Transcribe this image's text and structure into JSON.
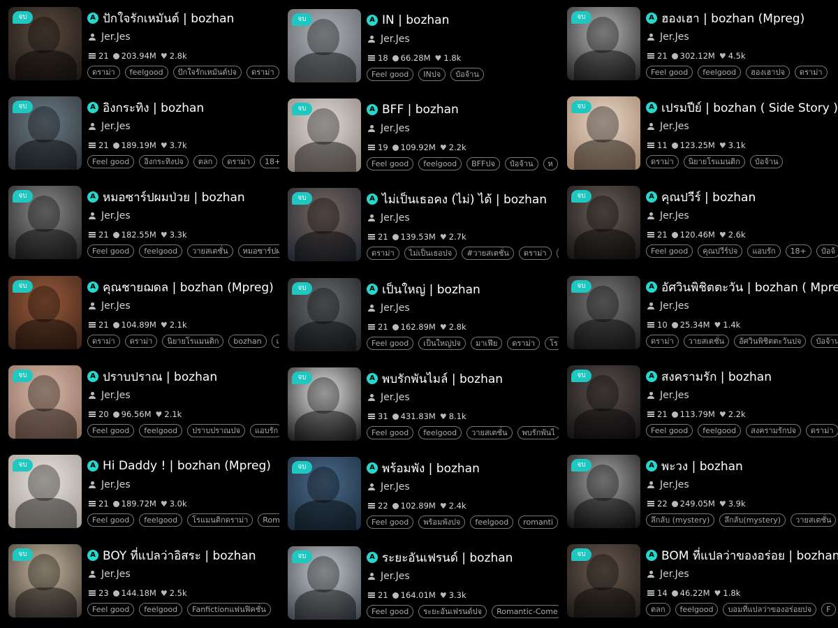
{
  "badge_label": "จบ",
  "accent_color": "#1ec8c0",
  "columns": [
    {
      "cards": [
        {
          "title": "ปักใจรักเหมันต์ | bozhan",
          "author": "Jer.Jes",
          "chapters": "21",
          "views": "203.94M",
          "likes": "2.8k",
          "tags": [
            "ดราม่า",
            "feelgood",
            "ปักใจรักเหมันต์ปจ",
            "ดราม่า"
          ],
          "cover": [
            "#5a4a3e",
            "#1a1512"
          ]
        },
        {
          "title": "อิงกระทิง | bozhan",
          "author": "Jer.Jes",
          "chapters": "21",
          "views": "189.19M",
          "likes": "3.7k",
          "tags": [
            "Feel good",
            "อิงกระทิงปจ",
            "ตลก",
            "ดราม่า",
            "18+"
          ],
          "cover": [
            "#6b7b86",
            "#2c3136"
          ]
        },
        {
          "title": "หมอซาร์ปผมป่วย | bozhan",
          "author": "Jer.Jes",
          "chapters": "21",
          "views": "182.55M",
          "likes": "3.3k",
          "tags": [
            "Feel good",
            "feelgood",
            "วายสเตชั่น",
            "หมอซาร์ปผ"
          ],
          "cover": [
            "#8c8c8c",
            "#1e1e1e"
          ]
        },
        {
          "title": "คุณชายฌดล | bozhan (Mpreg)",
          "author": "Jer.Jes",
          "chapters": "21",
          "views": "104.89M",
          "likes": "2.1k",
          "tags": [
            "ดราม่า",
            "ดราม่า",
            "นิยายโรแมนติก",
            "bozhan",
            "เ"
          ],
          "cover": [
            "#9a5a3a",
            "#3a2418"
          ]
        },
        {
          "title": "ปราบปราณ | bozhan",
          "author": "Jer.Jes",
          "chapters": "20",
          "views": "96.56M",
          "likes": "2.1k",
          "tags": [
            "Feel good",
            "feelgood",
            "ปราบปราณปจ",
            "แอบรัก"
          ],
          "cover": [
            "#d8b8a8",
            "#8a6a5a"
          ]
        },
        {
          "title": "Hi Daddy ! | bozhan (Mpreg)",
          "author": "Jer.Jes",
          "chapters": "21",
          "views": "189.72M",
          "likes": "3.0k",
          "tags": [
            "Feel good",
            "feelgood",
            "โรแมนติกดราม่า",
            "Rom"
          ],
          "cover": [
            "#e8e4e0",
            "#a09890"
          ]
        },
        {
          "title": "BOY ที่แปลว่าอิสระ  | bozhan",
          "author": "Jer.Jes",
          "chapters": "23",
          "views": "144.18M",
          "likes": "2.5k",
          "tags": [
            "Feel good",
            "feelgood",
            "Fanfictionแฟนฟิคชั่น"
          ],
          "cover": [
            "#c8b8a0",
            "#3a3430"
          ]
        }
      ]
    },
    {
      "cards": [
        {
          "title": "IN | bozhan",
          "author": "Jer.Jes",
          "chapters": "18",
          "views": "66.28M",
          "likes": "1.8k",
          "tags": [
            "Feel good",
            "INปจ",
            "ป๋อจ้าน"
          ],
          "cover": [
            "#b0b4b8",
            "#5a5e62"
          ]
        },
        {
          "title": "BFF | bozhan",
          "author": "Jer.Jes",
          "chapters": "19",
          "views": "109.92M",
          "likes": "2.2k",
          "tags": [
            "Feel good",
            "feelgood",
            "BFFปจ",
            "ป๋อจ้าน",
            "ห"
          ],
          "cover": [
            "#e0dcd8",
            "#8a7e78"
          ]
        },
        {
          "title": "ไม่เป็นเธอคง (ไม่) ได้ | bozhan",
          "author": "Jer.Jes",
          "chapters": "21",
          "views": "139.53M",
          "likes": "2.7k",
          "tags": [
            "ดราม่า",
            "ไม่เป็นเธอปจ",
            "#วายสเตชั่น",
            "ดราม่า",
            "ร"
          ],
          "cover": [
            "#7a6860",
            "#1c2430"
          ]
        },
        {
          "title": "เป็นใหญ่ | bozhan",
          "author": "Jer.Jes",
          "chapters": "21",
          "views": "162.89M",
          "likes": "2.8k",
          "tags": [
            "Feel good",
            "เป็นใหญ่ปจ",
            "มาเฟีย",
            "ดราม่า",
            "โร"
          ],
          "cover": [
            "#6a6e70",
            "#1a1c1e"
          ]
        },
        {
          "title": "พบรักพันไมล์ | bozhan",
          "author": "Jer.Jes",
          "chapters": "31",
          "views": "431.83M",
          "likes": "8.1k",
          "tags": [
            "Feel good",
            "feelgood",
            "วายสเตชั่น",
            "พบรักพันไ"
          ],
          "cover": [
            "#e8e8e8",
            "#151515"
          ]
        },
        {
          "title": "พร้อมพัง | bozhan",
          "author": "Jer.Jes",
          "chapters": "22",
          "views": "102.89M",
          "likes": "2.4k",
          "tags": [
            "Feel good",
            "พร้อมพังปจ",
            "feelgood",
            "romanti"
          ],
          "cover": [
            "#4a6a8a",
            "#1a2a3a"
          ]
        },
        {
          "title": "ระยะอันเฟรนด์ | bozhan",
          "author": "Jer.Jes",
          "chapters": "21",
          "views": "164.01M",
          "likes": "3.3k",
          "tags": [
            "Feel good",
            "ระยะอันเฟรนด์ปจ",
            "Romantic-Come"
          ],
          "cover": [
            "#c8ccd0",
            "#3a4048"
          ]
        }
      ]
    },
    {
      "cards": [
        {
          "title": "ฮองเฮา | bozhan (Mpreg)",
          "author": "Jer.Jes",
          "chapters": "21",
          "views": "302.12M",
          "likes": "4.5k",
          "tags": [
            "Feel good",
            "feelgood",
            "ฮองเฮาปจ",
            "ดราม่า"
          ],
          "cover": [
            "#b8b8b8",
            "#202020"
          ]
        },
        {
          "title": "เปรมปีย์ | bozhan ( Side Story )",
          "author": "Jer.Jes",
          "chapters": "11",
          "views": "123.25M",
          "likes": "3.1k",
          "tags": [
            "ดราม่า",
            "นิยายโรแมนติก",
            "ป๋อจ้าน"
          ],
          "cover": [
            "#e8d8c8",
            "#a08068"
          ]
        },
        {
          "title": "คุณปวีร์ | bozhan",
          "author": "Jer.Jes",
          "chapters": "21",
          "views": "120.46M",
          "likes": "2.6k",
          "tags": [
            "Feel good",
            "คุณปวีร์ปจ",
            "แอบรัก",
            "18+",
            "ป๋อจ้"
          ],
          "cover": [
            "#6a5e58",
            "#141212"
          ]
        },
        {
          "title": "อัศวินพิชิตตะวัน | bozhan ( Mpreg",
          "author": "Jer.Jes",
          "chapters": "10",
          "views": "25.34M",
          "likes": "1.4k",
          "tags": [
            "ดราม่า",
            "วายสเตชั่น",
            "อัศวินพิชิตตะวันปจ",
            "ป๋อจ้าน"
          ],
          "cover": [
            "#7a7a7a",
            "#1a1a1a"
          ]
        },
        {
          "title": "สงครามรัก | bozhan",
          "author": "Jer.Jes",
          "chapters": "21",
          "views": "113.79M",
          "likes": "2.2k",
          "tags": [
            "Feel good",
            "feelgood",
            "สงครามรักปจ",
            "ดราม่า"
          ],
          "cover": [
            "#5a5050",
            "#121010"
          ]
        },
        {
          "title": "พะวง | bozhan",
          "author": "Jer.Jes",
          "chapters": "22",
          "views": "249.05M",
          "likes": "3.9k",
          "tags": [
            "ลึกลับ (mystery)",
            "ลึกลับ(mystery)",
            "วายสเตชั่น"
          ],
          "cover": [
            "#a8a8a8",
            "#0e0e0e"
          ]
        },
        {
          "title": "BOM ที่แปลว่าของอร่อย | bozhan",
          "author": "Jer.Jes",
          "chapters": "14",
          "views": "46.22M",
          "likes": "1.8k",
          "tags": [
            "ตลก",
            "feelgood",
            "บอมที่แปลว่าของอร่อยปจ",
            "F"
          ],
          "cover": [
            "#6a5a50",
            "#1c1814"
          ]
        }
      ]
    }
  ]
}
